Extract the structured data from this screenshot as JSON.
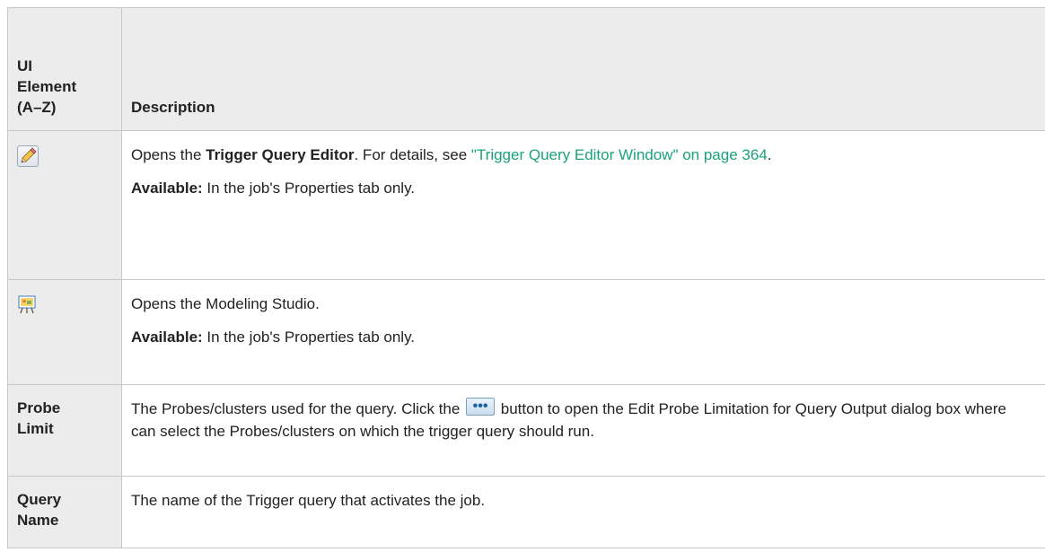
{
  "table": {
    "headers": {
      "col1_line1": "UI",
      "col1_line2": "Element",
      "col1_line3": "(A–Z)",
      "col2": "Description"
    },
    "rows": [
      {
        "icon": "pencil-edit-icon",
        "desc_prefix": "Opens the ",
        "desc_bold": "Trigger Query Editor",
        "desc_mid": ". For details, see ",
        "desc_link": "\"Trigger Query Editor Window\" on page 364",
        "desc_suffix": ".",
        "available_label": "Available:",
        "available_text": " In the job's Properties tab only."
      },
      {
        "icon": "modeling-studio-icon",
        "desc": "Opens the Modeling Studio.",
        "available_label": "Available:",
        "available_text": " In the job's Properties tab only."
      },
      {
        "label_line1": "Probe",
        "label_line2": "Limit",
        "desc_prefix": "The Probes/clusters used for the query. Click the ",
        "desc_icon": "ellipsis-button-icon",
        "desc_suffix": " button to open the Edit Probe Limitation for Query Output dialog box where can select the Probes/clusters on which the trigger query should run."
      },
      {
        "label_line1": "Query",
        "label_line2": "Name",
        "desc": "The name of the Trigger query that activates the job."
      }
    ]
  },
  "colors": {
    "header_bg": "#ececec",
    "border": "#c8c8c8",
    "link": "#1aa37a"
  }
}
